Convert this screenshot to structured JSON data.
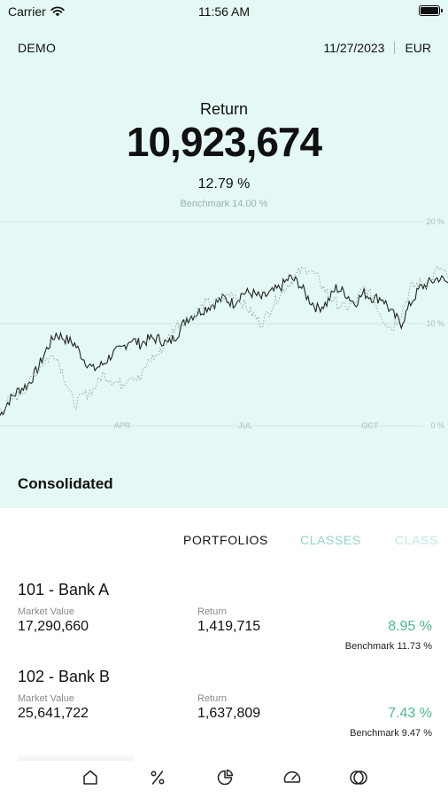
{
  "status_bar": {
    "carrier": "Carrier",
    "time": "11:56 AM"
  },
  "header": {
    "account": "DEMO",
    "date": "11/27/2023",
    "currency": "EUR"
  },
  "summary": {
    "label": "Return",
    "value": "10,923,674",
    "percent": "12.79 %",
    "benchmark": "Benchmark 14.00 %"
  },
  "chart_data": {
    "type": "line",
    "x_ticks": [
      "APR",
      "JUL",
      "OCT"
    ],
    "y_ticks": [
      "20 %",
      "10 %",
      "0 %"
    ],
    "ylim": [
      0,
      20
    ],
    "series": [
      {
        "style": "solid",
        "color": "#222222",
        "values": [
          1.0,
          2.5,
          3.5,
          4.0,
          5.5,
          7.5,
          9.0,
          8.5,
          8.0,
          6.5,
          5.5,
          6.0,
          7.0,
          7.5,
          8.5,
          8.0,
          8.5,
          8.5,
          8.0,
          9.0,
          10.5,
          11.0,
          11.5,
          12.0,
          12.5,
          12.0,
          13.0,
          13.0,
          12.5,
          13.0,
          13.5,
          14.5,
          14.0,
          12.5,
          11.5,
          12.0,
          13.5,
          13.0,
          12.0,
          13.0,
          12.5,
          12.5,
          11.0,
          10.0,
          12.0,
          13.5,
          14.0,
          14.5,
          14.0
        ]
      },
      {
        "style": "dotted",
        "color": "#9aa8a5",
        "values": [
          1.5,
          2.5,
          3.0,
          4.0,
          5.5,
          6.5,
          7.0,
          4.5,
          2.0,
          3.0,
          3.5,
          5.0,
          4.5,
          4.0,
          5.0,
          4.5,
          6.5,
          7.0,
          8.5,
          10.0,
          10.5,
          11.0,
          12.0,
          12.0,
          12.5,
          13.0,
          12.0,
          11.0,
          10.0,
          11.5,
          13.0,
          14.0,
          15.0,
          15.5,
          14.5,
          13.0,
          12.0,
          11.5,
          12.0,
          13.5,
          12.5,
          10.5,
          9.5,
          11.0,
          13.5,
          14.0,
          14.0,
          15.5,
          14.5
        ]
      }
    ]
  },
  "section_title": "Consolidated",
  "tabs": [
    "PORTFOLIOS",
    "CLASSES",
    "CLASS"
  ],
  "labels": {
    "market_value": "Market Value",
    "return": "Return"
  },
  "portfolios": [
    {
      "name": "101 - Bank A",
      "market_value": "17,290,660",
      "return": "1,419,715",
      "percent": "8.95 %",
      "benchmark": "Benchmark 11.73 %"
    },
    {
      "name": "102 - Bank B",
      "market_value": "25,641,722",
      "return": "1,637,809",
      "percent": "7.43 %",
      "benchmark": "Benchmark 9.47 %"
    }
  ],
  "bottom_nav": [
    {
      "icon": "home-icon"
    },
    {
      "icon": "percent-icon"
    },
    {
      "icon": "pie-chart-icon"
    },
    {
      "icon": "gauge-icon"
    },
    {
      "icon": "overlap-circles-icon"
    }
  ]
}
